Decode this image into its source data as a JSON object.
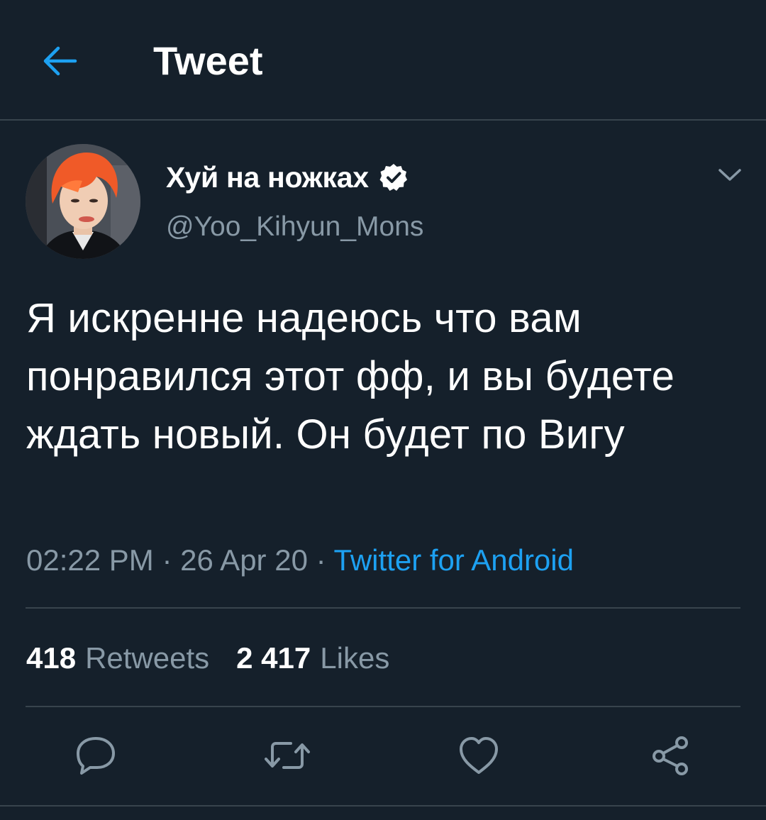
{
  "header": {
    "title": "Tweet",
    "back_icon": "arrow-left-icon"
  },
  "tweet": {
    "author": {
      "display_name": "Хуй на ножках",
      "handle": "@Yoo_Kihyun_Mons",
      "verified": true
    },
    "text": "Я искренне надеюсь что вам понравился этот фф, и вы будете ждать новый. Он будет по Вигу",
    "time": "02:22 PM",
    "sep1": " · ",
    "date": "26 Apr 20",
    "sep2": " · ",
    "source": "Twitter for Android"
  },
  "stats": {
    "retweets_count": "418",
    "retweets_label": "Retweets",
    "likes_count": "2 417",
    "likes_label": "Likes"
  },
  "actions": {
    "reply_icon": "reply-icon",
    "retweet_icon": "retweet-icon",
    "like_icon": "heart-icon",
    "share_icon": "share-icon"
  },
  "colors": {
    "background": "#15202b",
    "accent": "#1da1f2",
    "secondary_text": "#8899a6",
    "divider": "#38444d"
  }
}
